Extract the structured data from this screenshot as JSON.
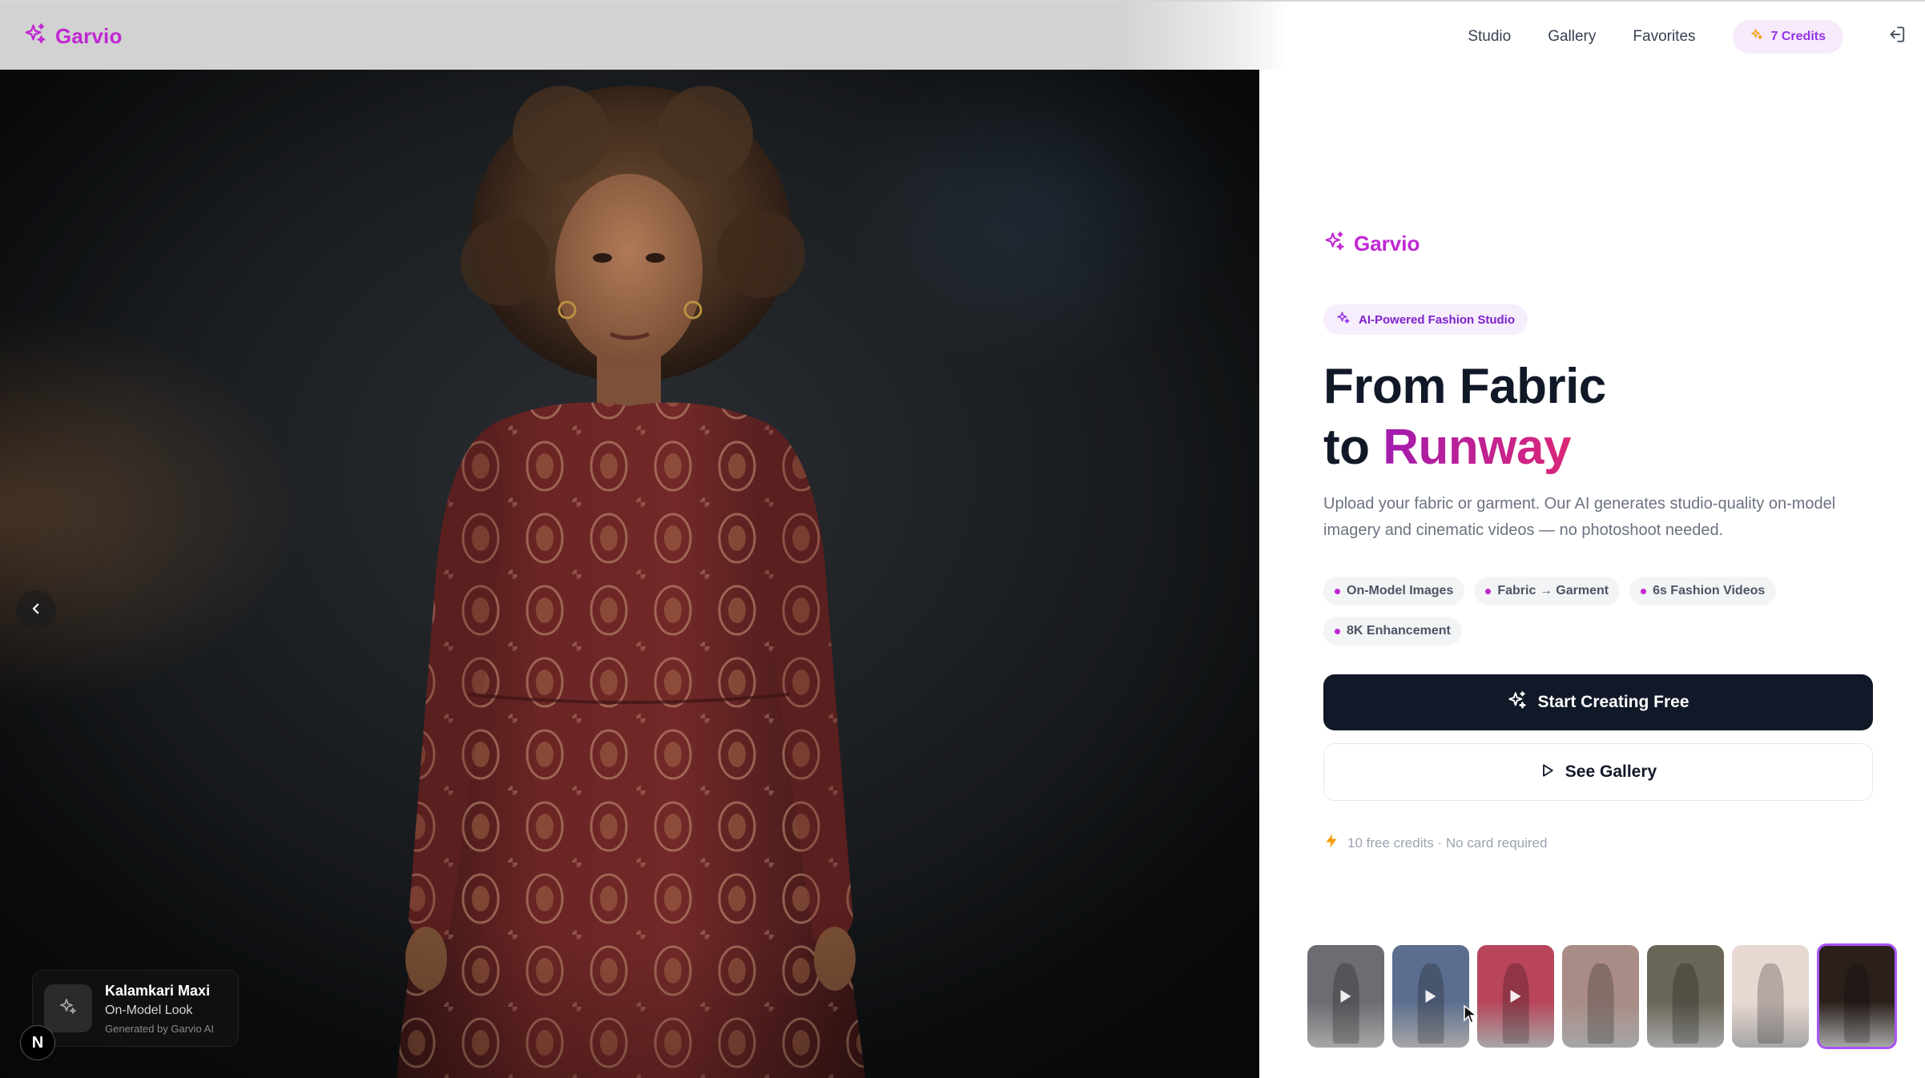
{
  "app": {
    "name": "Garvio"
  },
  "nav": {
    "links": [
      "Studio",
      "Gallery",
      "Favorites"
    ],
    "credits_label": "7 Credits"
  },
  "hero": {
    "caption_title": "Kalamkari Maxi",
    "caption_subtitle": "On-Model Look",
    "caption_meta": "Generated by Garvio AI",
    "slide_count": 7,
    "active_slide": 7,
    "n_badge": "N"
  },
  "panel": {
    "brand": "Garvio",
    "pill": "AI-Powered Fashion Studio",
    "headline_line1": "From Fabric",
    "headline_to": "to",
    "headline_accent": "Runway",
    "description": "Upload your fabric or garment. Our AI generates studio-quality on-model imagery and cinematic videos — no photoshoot needed.",
    "features": [
      "On-Model Images",
      "Fabric → Garment",
      "6s Fashion Videos",
      "8K Enhancement"
    ],
    "primary_cta": "Start Creating Free",
    "secondary_cta": "See Gallery",
    "note": "10 free credits · No card required"
  },
  "thumbnails": [
    {
      "kind": "video",
      "bg": "#6b6d72"
    },
    {
      "kind": "video",
      "bg": "#5c6e8f"
    },
    {
      "kind": "video",
      "bg": "#b8455a"
    },
    {
      "kind": "image",
      "bg": "#a98c86"
    },
    {
      "kind": "image",
      "bg": "#6a6658"
    },
    {
      "kind": "image",
      "bg": "#e8d8d2"
    },
    {
      "kind": "image",
      "bg": "#2a1f1a",
      "active": true
    }
  ],
  "colors": {
    "accent": "#c026d3",
    "accent2": "#db2777",
    "primary_button": "#111827",
    "credits_text": "#9333ea"
  }
}
